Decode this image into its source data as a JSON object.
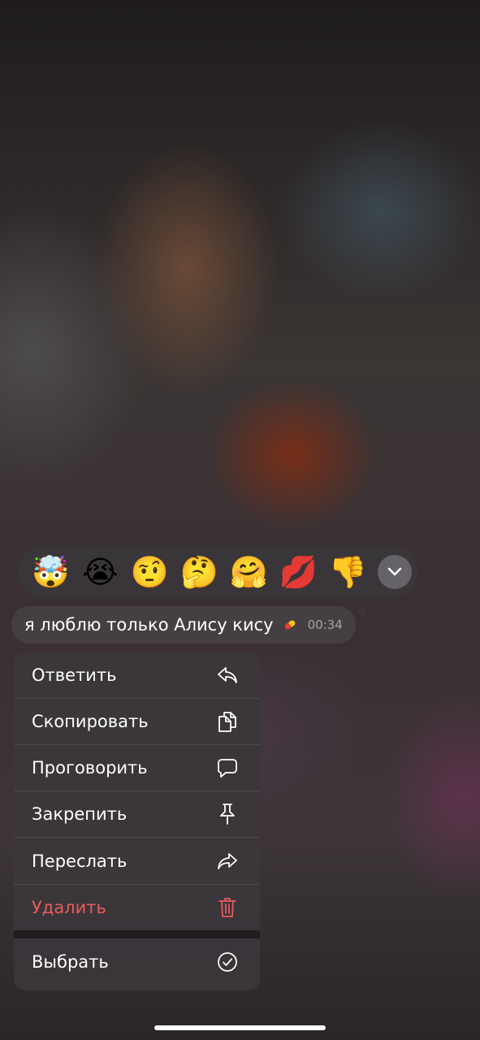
{
  "reactions": [
    {
      "emoji": "🤯",
      "name": "exploding-head"
    },
    {
      "emoji": "😭",
      "name": "loudly-crying"
    },
    {
      "emoji": "🤨",
      "name": "raised-eyebrow"
    },
    {
      "emoji": "🤔",
      "name": "thinking"
    },
    {
      "emoji": "🤗",
      "name": "hugging"
    },
    {
      "emoji": "💋",
      "name": "kiss-mark"
    },
    {
      "emoji": "👎",
      "name": "thumbs-down"
    }
  ],
  "message": {
    "text": "я люблю только Алису кису",
    "time": "00:34"
  },
  "menu": {
    "reply": "Ответить",
    "copy": "Скопировать",
    "speak": "Проговорить",
    "pin": "Закрепить",
    "forward": "Переслать",
    "delete": "Удалить",
    "select": "Выбрать"
  },
  "colors": {
    "danger": "#eb5a5a",
    "menu_bg": "#3a363a",
    "text": "#ffffff"
  }
}
